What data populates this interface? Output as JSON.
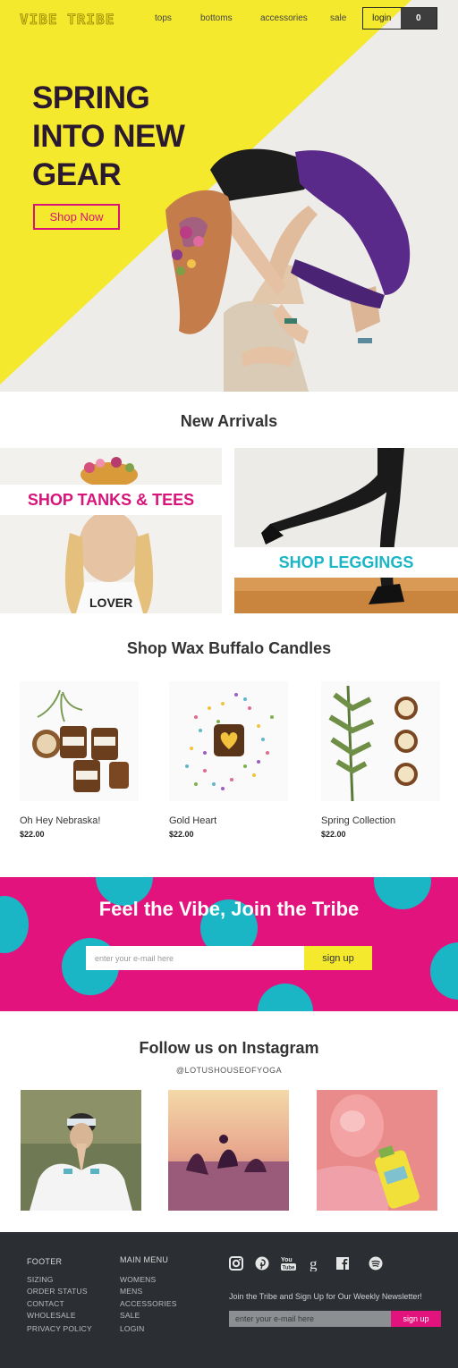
{
  "brand": {
    "logo": "VIBE TRIBE"
  },
  "nav": {
    "links": [
      "tops",
      "bottoms",
      "accessories",
      "sale"
    ],
    "login_label": "login",
    "cart_count": "0"
  },
  "hero": {
    "title_lines": [
      "SPRING",
      "INTO NEW",
      "GEAR"
    ],
    "cta_label": "Shop Now"
  },
  "new_arrivals": {
    "title": "New Arrivals",
    "tiles": [
      {
        "label": "SHOP TANKS & TEES",
        "color": "#d8147a"
      },
      {
        "label": "SHOP LEGGINGS",
        "color": "#1ab6c6"
      }
    ]
  },
  "candles": {
    "title": "Shop Wax Buffalo Candles",
    "products": [
      {
        "name": "Oh Hey Nebraska!",
        "price": "$22.00"
      },
      {
        "name": "Gold Heart",
        "price": "$22.00"
      },
      {
        "name": "Spring Collection",
        "price": "$22.00"
      }
    ]
  },
  "newsletter": {
    "title": "Feel the Vibe, Join the Tribe",
    "placeholder": "enter your e-mail here",
    "button_label": "sign up"
  },
  "instagram": {
    "title": "Follow us on Instagram",
    "handle": "@LOTUSHOUSEOFYOGA"
  },
  "footer": {
    "col1_heading": "FOOTER",
    "col1_links": [
      "SIZING",
      "ORDER STATUS",
      "CONTACT",
      "WHOLESALE",
      "PRIVACY POLICY"
    ],
    "col2_heading": "MAIN MENU",
    "col2_links": [
      "WOMENS",
      "MENS",
      "ACCESSORIES",
      "SALE",
      "LOGIN"
    ],
    "social_icons": [
      "instagram-icon",
      "pinterest-icon",
      "youtube-icon",
      "google-icon",
      "facebook-icon",
      "spotify-icon"
    ],
    "newsletter_text": "Join the Tribe and Sign Up for Our Weekly Newsletter!",
    "placeholder": "enter your e-mail here",
    "button_label": "sign up"
  },
  "colors": {
    "yellow": "#f4e92d",
    "magenta": "#e2137c",
    "teal": "#1ab6c6",
    "footer_bg": "#2b2f34"
  }
}
